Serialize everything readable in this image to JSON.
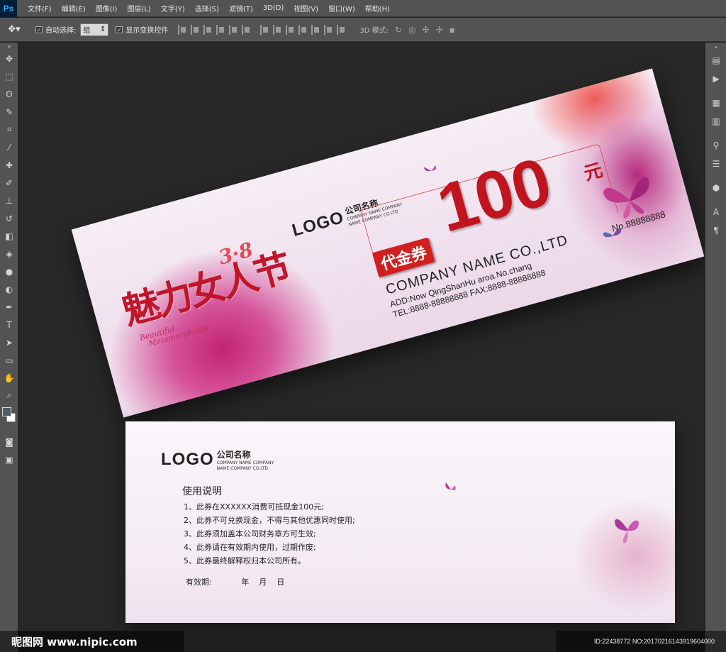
{
  "app": {
    "logo": "Ps"
  },
  "menu": [
    "文件(F)",
    "编辑(E)",
    "图像(I)",
    "图层(L)",
    "文字(Y)",
    "选择(S)",
    "滤镜(T)",
    "3D(D)",
    "视图(V)",
    "窗口(W)",
    "帮助(H)"
  ],
  "options": {
    "auto_select_label": "自动选择:",
    "auto_select_value": "组",
    "show_transform_label": "显示变换控件",
    "mode3d_label": "3D 模式:"
  },
  "front": {
    "logo": "LOGO",
    "company_cn": "公司名称",
    "company_en_1": "COMPANY NAME COMPANY",
    "company_en_2": "NAME COMPANY CO.LTD",
    "title_cn": "魅力女人节",
    "title_num": "3·8",
    "title_en_1": "Beautiful",
    "title_en_2": "Metamorphosis",
    "value": "100",
    "unit": "元",
    "badge": "代金券",
    "company_name_big": "COMPANY NAME CO.,LTD",
    "address": "ADD:Now QingShanHu aroa.No.chang",
    "phone": "TEL:8888-88888888  FAX:8888-88888888",
    "serial": "No.88888888"
  },
  "back": {
    "logo": "LOGO",
    "company_cn": "公司名称",
    "company_en_1": "COMPANY NAME COMPANY",
    "company_en_2": "NAME COMPANY CO.LTD",
    "title": "使用说明",
    "rules": [
      "1、此券在XXXXXX消费可抵现金100元;",
      "2、此券不可兑换现金，不得与其他优惠同时使用;",
      "3、此券须加盖本公司财务章方可生效;",
      "4、此券请在有效期内使用，过期作废;",
      "5、此券最终解释权归本公司所有。"
    ],
    "valid_label": "有效期:",
    "valid_fields": "年    月    日"
  },
  "watermark": {
    "left": "昵图网 www.nipic.com",
    "right": "ID:22438772 NO:20170216143919604000"
  },
  "colors": {
    "accent_red": "#c0141f",
    "ps_blue": "#31a8ff"
  }
}
